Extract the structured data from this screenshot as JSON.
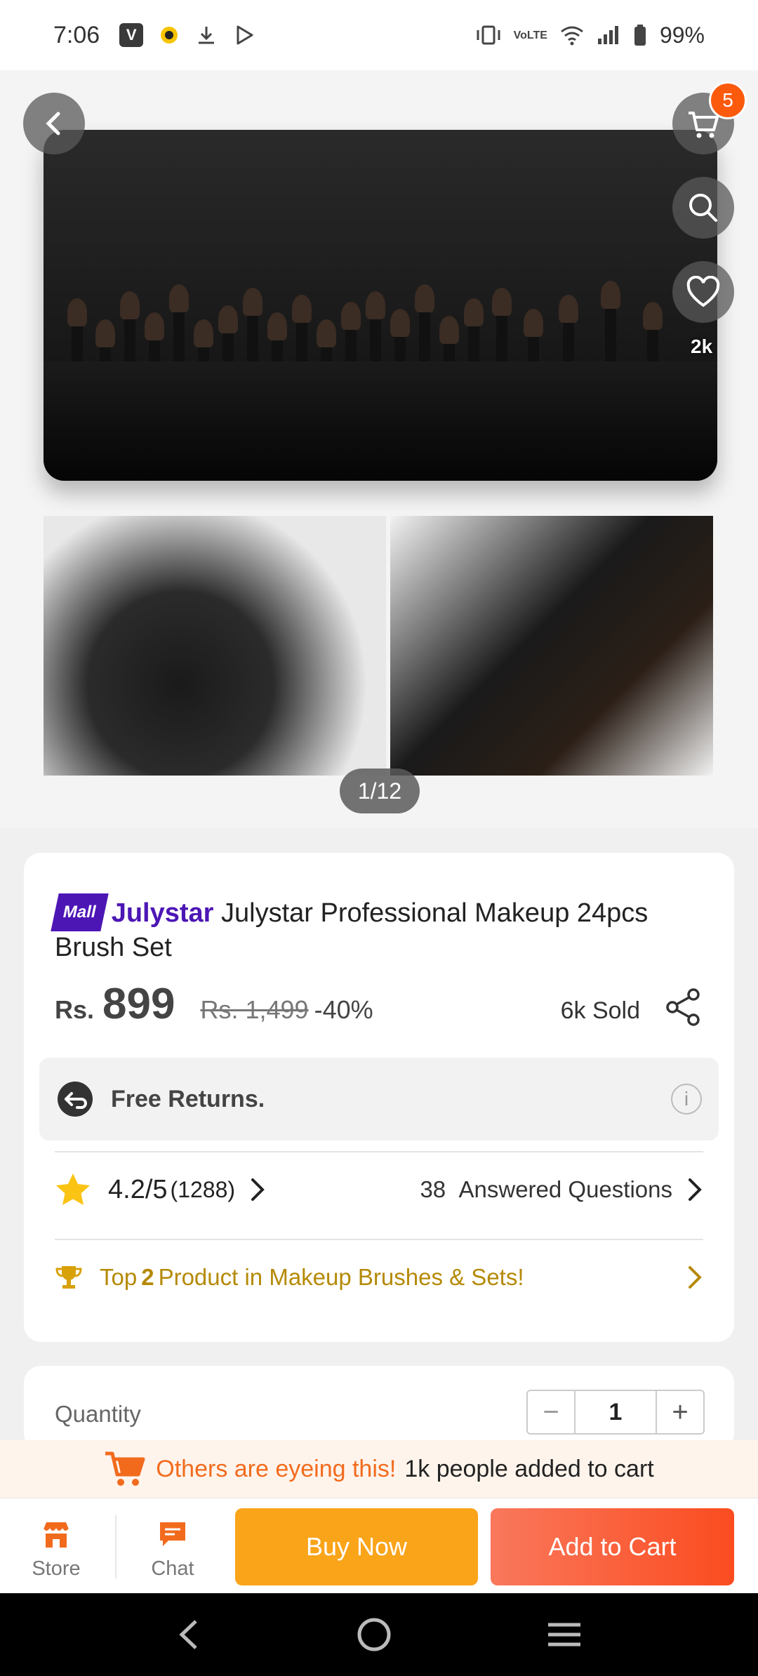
{
  "status_bar": {
    "time": "7:06",
    "battery": "99%",
    "icons": [
      "v-app-icon",
      "chat-app-icon",
      "download-icon",
      "play-store-icon",
      "vibrate-icon",
      "volte-icon",
      "wifi-icon",
      "signal-icon",
      "battery-icon"
    ]
  },
  "gallery": {
    "pager": "1/12",
    "cart_badge": "5",
    "likes": "2k"
  },
  "product": {
    "mall_tag": "Mall",
    "store_name": "Julystar",
    "title": "Julystar  Professional Makeup 24pcs Brush Set",
    "currency": "Rs.",
    "price": "899",
    "original_price": "Rs. 1,499",
    "discount": "-40%",
    "sold": "6k Sold",
    "returns": "Free Returns.",
    "info": "i",
    "rating": "4.2/5",
    "rating_count": "(1288)",
    "answered_count": "38",
    "answered_label": "Answered Questions",
    "top_prefix": "Top",
    "top_rank": "2",
    "top_suffix": "Product in Makeup Brushes & Sets!"
  },
  "quantity": {
    "label": "Quantity",
    "minus": "−",
    "value": "1",
    "plus": "+"
  },
  "eyeing": {
    "hot_text": "Others are eyeing this!",
    "count_text": "1k people added to cart"
  },
  "bottom_bar": {
    "store_label": "Store",
    "chat_label": "Chat",
    "buy_now": "Buy Now",
    "add_to_cart": "Add to Cart"
  },
  "colors": {
    "accent_orange": "#fb5a0d",
    "mall_purple": "#4c16b5",
    "buy_now": "#faa41a",
    "add_to_cart": "#fb4c20",
    "gold": "#b58a06"
  }
}
